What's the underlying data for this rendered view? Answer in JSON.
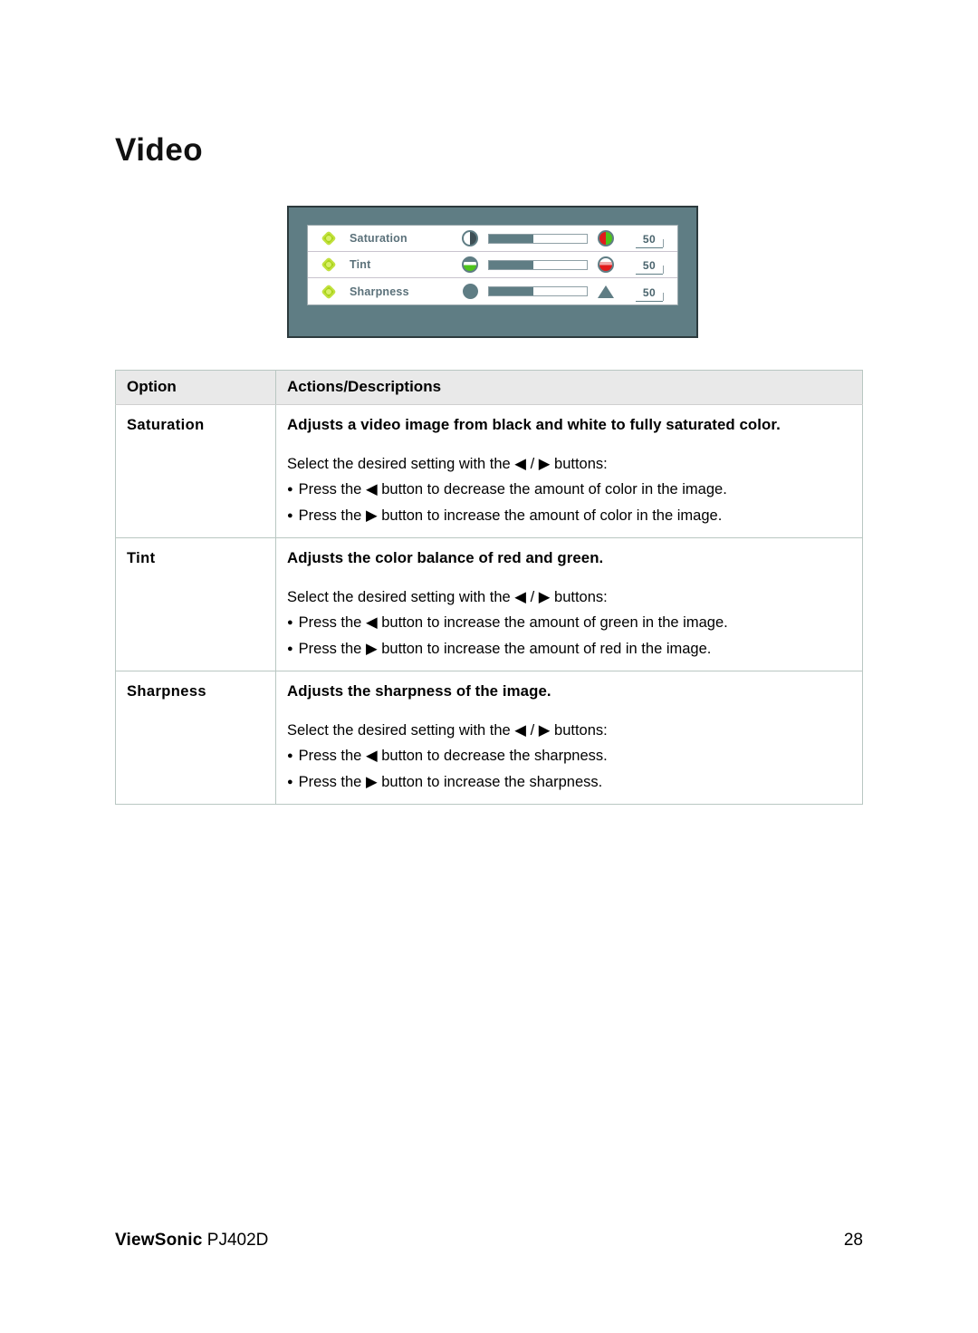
{
  "page": {
    "title": "Video"
  },
  "osd": {
    "rows": [
      {
        "label": "Saturation",
        "left_icon": "contrast-circle-icon",
        "right_icon": "red-green-circle-icon",
        "fill_percent": 45,
        "value": "50"
      },
      {
        "label": "Tint",
        "left_icon": "green-band-circle-icon",
        "right_icon": "red-band-circle-icon",
        "fill_percent": 45,
        "value": "50"
      },
      {
        "label": "Sharpness",
        "left_icon": "soft-blob-icon",
        "right_icon": "sharp-triangle-icon",
        "fill_percent": 45,
        "value": "50"
      }
    ],
    "colors": {
      "panel": "#5f7d84",
      "panel_border": "#2c3a3d",
      "led": "#a9d21b",
      "red": "#e21b1b",
      "green": "#4fc41b"
    }
  },
  "table": {
    "headers": [
      "Option",
      "Actions/Descriptions"
    ],
    "rows": [
      {
        "option": "Saturation",
        "summary": "Adjusts a video image from black and white to fully saturated color.",
        "intro": "Select the desired setting with the ◀ / ▶ buttons:",
        "bullets": [
          "Press the ◀ button to decrease the amount of color in the image.",
          "Press the ▶ button to increase the amount of color in the image."
        ]
      },
      {
        "option": "Tint",
        "summary": "Adjusts the color balance of red and green.",
        "intro": "Select the desired setting with the ◀ / ▶ buttons:",
        "bullets": [
          "Press the ◀ button to increase the amount of green in the image.",
          "Press the ▶ button to increase the amount of red in the image."
        ]
      },
      {
        "option": "Sharpness",
        "summary": "Adjusts the sharpness of the image.",
        "intro": "Select the desired setting with the ◀ / ▶ buttons:",
        "bullets": [
          "Press the ◀ button to decrease the sharpness.",
          "Press the ▶ button to increase the sharpness."
        ]
      }
    ]
  },
  "footer": {
    "brand": "ViewSonic",
    "model": "PJ402D",
    "page_number": "28"
  }
}
